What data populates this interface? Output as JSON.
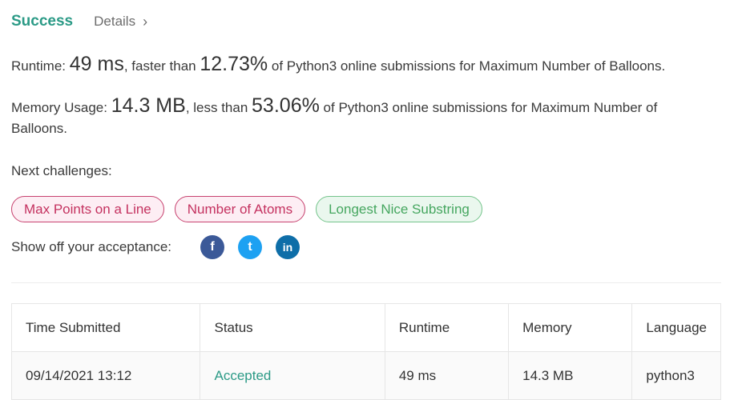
{
  "header": {
    "status": "Success",
    "details": "Details",
    "chevron": "›"
  },
  "runtime": {
    "label": "Runtime: ",
    "value": "49 ms",
    "mid": ", faster than ",
    "percent": "12.73%",
    "suffix": " of Python3 online submissions for Maximum Number of Balloons."
  },
  "memory": {
    "label": "Memory Usage: ",
    "value": "14.3 MB",
    "mid": ", less than ",
    "percent": "53.06%",
    "suffix": " of Python3 online submissions for Maximum Number of Balloons."
  },
  "next_label": "Next challenges:",
  "challenges": [
    {
      "label": "Max Points on a Line",
      "difficulty": "hard"
    },
    {
      "label": "Number of Atoms",
      "difficulty": "hard"
    },
    {
      "label": "Longest Nice Substring",
      "difficulty": "easy"
    }
  ],
  "share": {
    "label": "Show off your acceptance:",
    "icons": [
      "facebook-icon",
      "twitter-icon",
      "linkedin-icon"
    ],
    "glyphs": {
      "facebook": "f",
      "twitter": "t",
      "linkedin": "in"
    }
  },
  "table": {
    "headers": [
      "Time Submitted",
      "Status",
      "Runtime",
      "Memory",
      "Language"
    ],
    "rows": [
      [
        "09/14/2021 13:12",
        "Accepted",
        "49 ms",
        "14.3 MB",
        "python3"
      ]
    ]
  },
  "colors": {
    "accent": "#2b9a86",
    "hard": "#c4315f",
    "easy": "#45a65f"
  }
}
